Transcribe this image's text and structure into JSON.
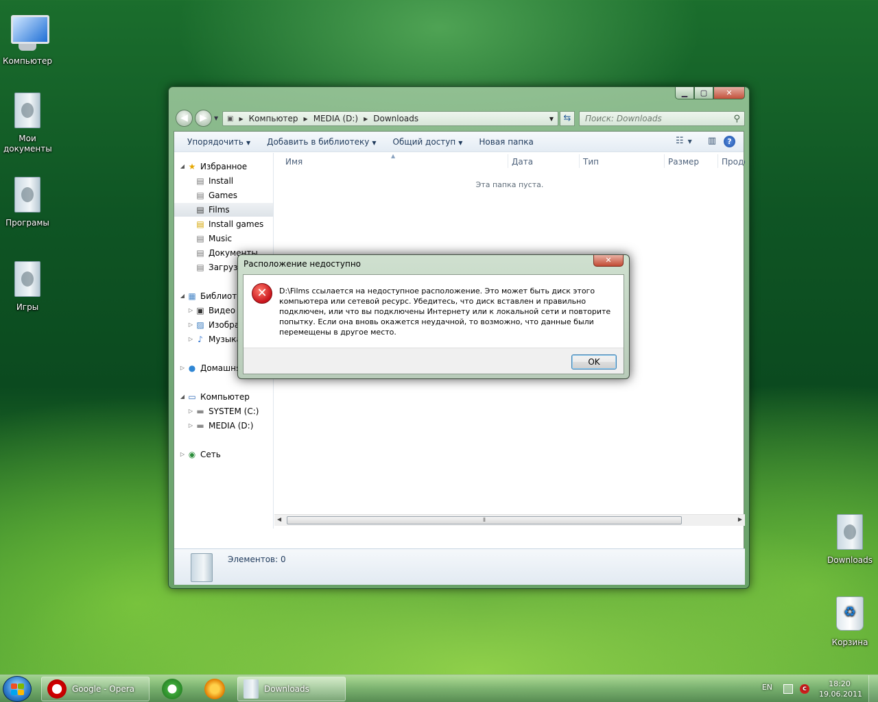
{
  "desktop": {
    "icons": [
      {
        "label": "Компьютер"
      },
      {
        "label": "Мои документы"
      },
      {
        "label": "Програмы"
      },
      {
        "label": "Игры"
      },
      {
        "label": "Downloads"
      },
      {
        "label": "Корзина"
      }
    ]
  },
  "explorer": {
    "address": {
      "crumbs": [
        "Компьютер",
        "MEDIA (D:)",
        "Downloads"
      ]
    },
    "search": {
      "placeholder": "Поиск: Downloads"
    },
    "toolbar": {
      "organize": "Упорядочить",
      "add_to_library": "Добавить в библиотеку",
      "share": "Общий доступ",
      "new_folder": "Новая папка"
    },
    "nav": {
      "favorites": "Избранное",
      "fav_items": [
        "Install",
        "Games",
        "Films",
        "Install games",
        "Music",
        "Документы",
        "Загрузки"
      ],
      "libraries": "Библиотеки",
      "lib_items": [
        "Видео",
        "Изображения",
        "Музыка"
      ],
      "homegroup": "Домашняя группа",
      "computer": "Компьютер",
      "drives": [
        "SYSTEM (C:)",
        "MEDIA (D:)"
      ],
      "network": "Сеть"
    },
    "columns": [
      "Имя",
      "Дата",
      "Тип",
      "Размер",
      "Продолжительность"
    ],
    "empty_message": "Эта папка пуста.",
    "status": "Элементов: 0"
  },
  "dialog": {
    "title": "Расположение недоступно",
    "message": "D:\\Films ссылается на недоступное расположение. Это может быть диск этого компьютера или сетевой ресурс. Убедитесь, что диск вставлен и правильно подключен, или что вы подключены Интернету или к локальной сети и повторите попытку. Если она вновь окажется неудачной, то возможно, что данные были перемещены в другое место.",
    "ok_label": "OK"
  },
  "taskbar": {
    "tasks": [
      {
        "label": "Google - Opera",
        "icon": "opera-icon"
      },
      {
        "label": "Downloads",
        "icon": "folder-icon"
      }
    ],
    "pinned": [
      "utorrent-icon",
      "aimp-icon"
    ],
    "language": "EN",
    "time": "18:20",
    "date": "19.06.2011"
  }
}
